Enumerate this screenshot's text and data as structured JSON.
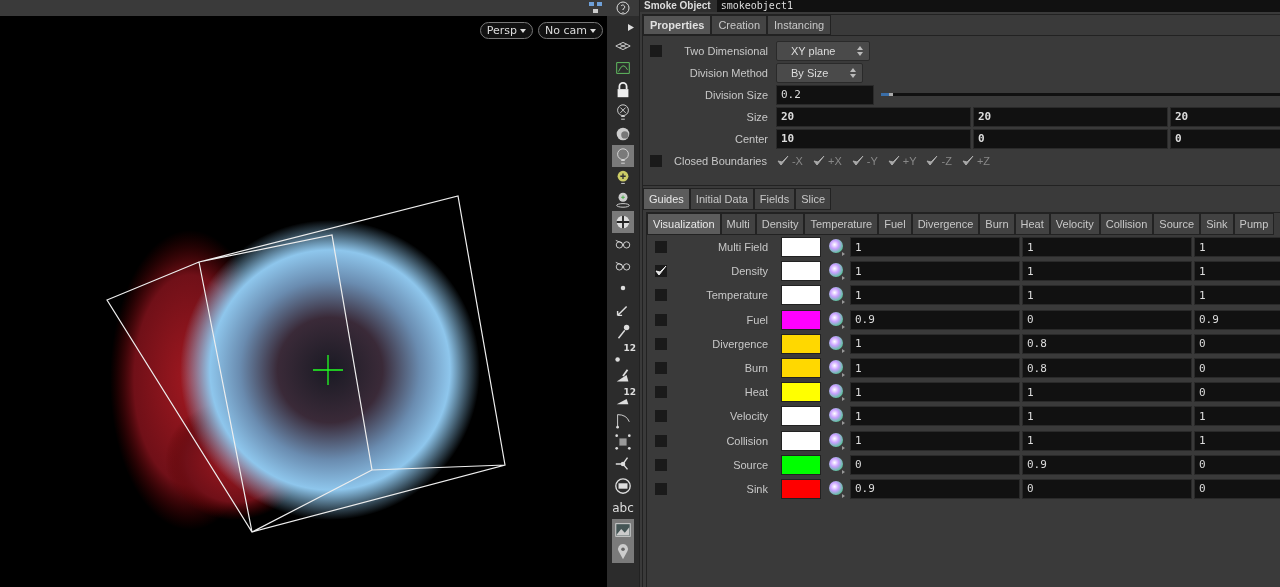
{
  "viewport": {
    "view_menus": [
      "Persp",
      "No cam"
    ]
  },
  "shelf": {
    "tools": [
      {
        "kind": "grid",
        "selected": false
      },
      {
        "kind": "curve",
        "selected": false
      },
      {
        "kind": "lock",
        "selected": false
      },
      {
        "kind": "bulb-x",
        "selected": false
      },
      {
        "kind": "dome",
        "selected": false
      },
      {
        "kind": "bulb",
        "selected": true
      },
      {
        "kind": "bulb-plus",
        "selected": false
      },
      {
        "kind": "bulb-pin",
        "selected": false
      },
      {
        "kind": "sphere",
        "selected": true
      },
      {
        "kind": "glasses",
        "selected": false
      },
      {
        "kind": "glasses",
        "selected": false
      },
      {
        "kind": "dot",
        "selected": false
      },
      {
        "kind": "wand",
        "selected": false
      },
      {
        "kind": "pin",
        "selected": false
      },
      {
        "kind": "dot-number",
        "selected": false,
        "label": "12"
      },
      {
        "kind": "brush",
        "selected": false
      },
      {
        "kind": "brush-number",
        "selected": false,
        "label": "12"
      },
      {
        "kind": "bend",
        "selected": false
      },
      {
        "kind": "dots",
        "selected": false
      },
      {
        "kind": "fork",
        "selected": false
      },
      {
        "kind": "disc",
        "selected": false
      },
      {
        "kind": "text",
        "selected": false,
        "label": "abc"
      },
      {
        "kind": "image",
        "selected": true
      },
      {
        "kind": "marker",
        "selected": true
      }
    ]
  },
  "node": {
    "type": "Smoke Object",
    "name": "smokeobject1"
  },
  "tabs": [
    {
      "label": "Properties",
      "selected": true
    },
    {
      "label": "Creation",
      "selected": false
    },
    {
      "label": "Instancing",
      "selected": false
    }
  ],
  "parameters": [
    {
      "kind": "menu",
      "label": "Two Dimensional",
      "checked": false,
      "value": "XY plane"
    },
    {
      "kind": "menu",
      "label": "Division Method",
      "value": "By Size"
    },
    {
      "kind": "slider",
      "label": "Division Size",
      "value": "0.2",
      "level": 0.02
    },
    {
      "kind": "vector",
      "label": "Size",
      "values": [
        "20",
        "20",
        "20"
      ]
    },
    {
      "kind": "vector",
      "label": "Center",
      "values": [
        "10",
        "0",
        "0"
      ]
    },
    {
      "kind": "axes",
      "label": "Closed Boundaries",
      "checked": false,
      "axes": [
        {
          "label": "-X",
          "disabled": true
        },
        {
          "label": "+X",
          "disabled": true
        },
        {
          "label": "-Y",
          "disabled": true
        },
        {
          "label": "+Y",
          "disabled": true
        },
        {
          "label": "-Z",
          "disabled": true
        },
        {
          "label": "+Z",
          "disabled": true
        }
      ]
    }
  ],
  "sub_tabs": [
    {
      "label": "Guides",
      "selected": true
    },
    {
      "label": "Initial Data",
      "selected": false
    },
    {
      "label": "Fields",
      "selected": false
    },
    {
      "label": "Slice",
      "selected": false
    }
  ],
  "visualization_tabs": [
    {
      "label": "Visualization",
      "selected": true
    },
    {
      "label": "Multi",
      "selected": false
    },
    {
      "label": "Density",
      "selected": false
    },
    {
      "label": "Temperature",
      "selected": false
    },
    {
      "label": "Fuel",
      "selected": false
    },
    {
      "label": "Divergence",
      "selected": false
    },
    {
      "label": "Burn",
      "selected": false
    },
    {
      "label": "Heat",
      "selected": false
    },
    {
      "label": "Velocity",
      "selected": false
    },
    {
      "label": "Collision",
      "selected": false
    },
    {
      "label": "Source",
      "selected": false
    },
    {
      "label": "Sink",
      "selected": false
    },
    {
      "label": "Pump",
      "selected": false
    }
  ],
  "fields": [
    {
      "label": "Multi Field",
      "checked": false,
      "color": "#ffffff",
      "values": [
        "1",
        "1",
        "1"
      ]
    },
    {
      "label": "Density",
      "checked": true,
      "color": "#ffffff",
      "values": [
        "1",
        "1",
        "1"
      ]
    },
    {
      "label": "Temperature",
      "checked": false,
      "color": "#ffffff",
      "values": [
        "1",
        "1",
        "1"
      ]
    },
    {
      "label": "Fuel",
      "checked": false,
      "color": "#ff00ff",
      "values": [
        "0.9",
        "0",
        "0.9"
      ]
    },
    {
      "label": "Divergence",
      "checked": false,
      "color": "#ffd800",
      "values": [
        "1",
        "0.8",
        "0"
      ]
    },
    {
      "label": "Burn",
      "checked": false,
      "color": "#ffd800",
      "values": [
        "1",
        "0.8",
        "0"
      ]
    },
    {
      "label": "Heat",
      "checked": false,
      "color": "#ffff00",
      "values": [
        "1",
        "1",
        "0"
      ]
    },
    {
      "label": "Velocity",
      "checked": false,
      "color": "#ffffff",
      "values": [
        "1",
        "1",
        "1"
      ]
    },
    {
      "label": "Collision",
      "checked": false,
      "color": "#ffffff",
      "values": [
        "1",
        "1",
        "1"
      ]
    },
    {
      "label": "Source",
      "checked": false,
      "color": "#00ff00",
      "values": [
        "0",
        "0.9",
        "0"
      ]
    },
    {
      "label": "Sink",
      "checked": false,
      "color": "#ff0000",
      "values": [
        "0.9",
        "0",
        "0"
      ]
    }
  ]
}
